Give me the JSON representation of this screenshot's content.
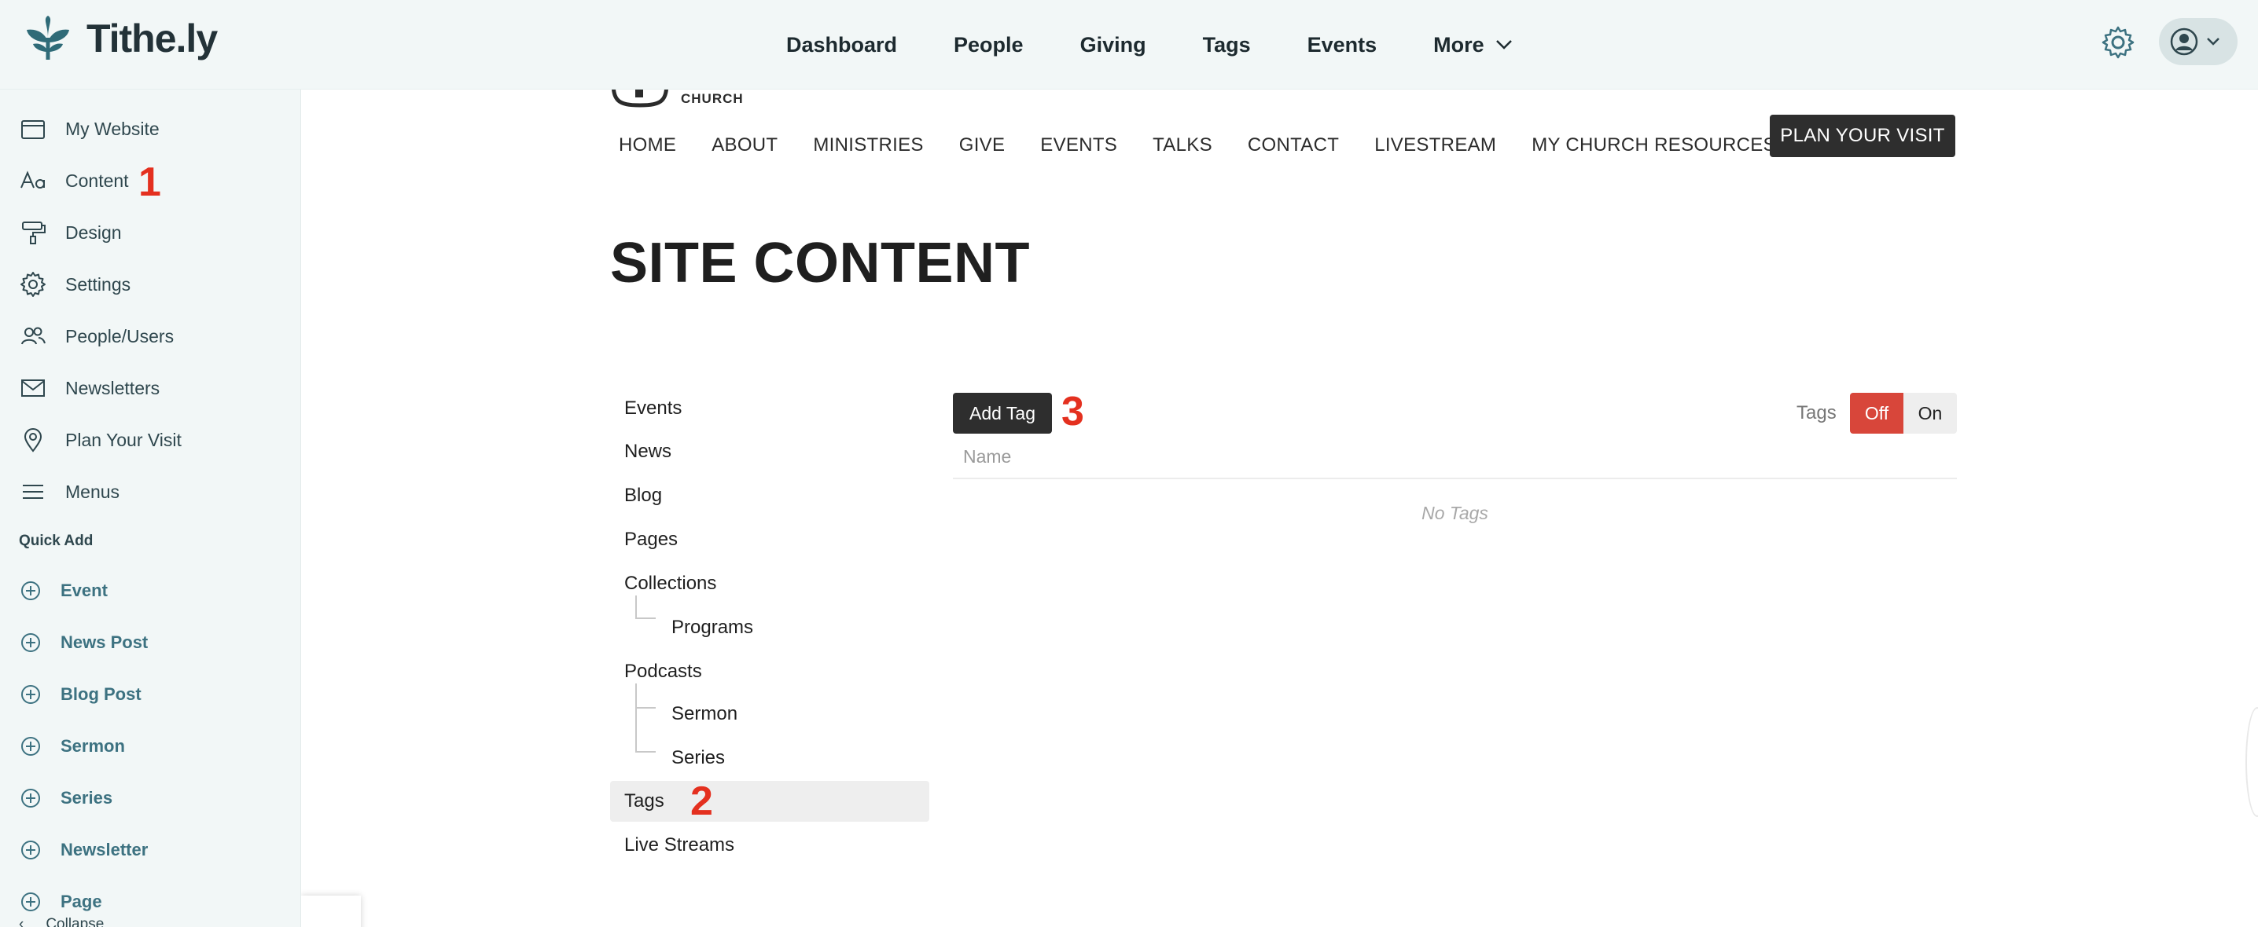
{
  "app": {
    "brand_name": "Tithe.ly",
    "accent_color": "#3d7281"
  },
  "topnav": {
    "items": [
      "Dashboard",
      "People",
      "Giving",
      "Tags",
      "Events",
      "More"
    ],
    "settings_icon": "gear-icon",
    "account_icon": "user-circle-icon"
  },
  "sidebar": {
    "items": [
      {
        "label": "My Website",
        "icon": "browser-window-icon"
      },
      {
        "label": "Content",
        "icon": "text-aa-icon"
      },
      {
        "label": "Design",
        "icon": "paint-roller-icon"
      },
      {
        "label": "Settings",
        "icon": "gear-icon"
      },
      {
        "label": "People/Users",
        "icon": "users-icon"
      },
      {
        "label": "Newsletters",
        "icon": "envelope-icon"
      },
      {
        "label": "Plan Your Visit",
        "icon": "map-pin-icon"
      },
      {
        "label": "Menus",
        "icon": "hamburger-menu-icon"
      }
    ],
    "quick_add_title": "Quick Add",
    "quick_add": [
      "Event",
      "News Post",
      "Blog Post",
      "Sermon",
      "Series",
      "Newsletter",
      "Page"
    ],
    "collapse_label": "Collapse"
  },
  "annotations": [
    "1",
    "2",
    "3"
  ],
  "site": {
    "logo_text": "CHURCH",
    "nav": [
      "HOME",
      "ABOUT",
      "MINISTRIES",
      "GIVE",
      "EVENTS",
      "TALKS",
      "CONTACT",
      "LIVESTREAM",
      "MY CHURCH RESOURCES"
    ],
    "plan_button": "PLAN YOUR VISIT",
    "page_title": "SITE CONTENT"
  },
  "content_nav": {
    "items": [
      {
        "label": "Events",
        "level": 0
      },
      {
        "label": "News",
        "level": 0
      },
      {
        "label": "Blog",
        "level": 0
      },
      {
        "label": "Pages",
        "level": 0
      },
      {
        "label": "Collections",
        "level": 0
      },
      {
        "label": "Programs",
        "level": 1
      },
      {
        "label": "Podcasts",
        "level": 0
      },
      {
        "label": "Sermon",
        "level": 1
      },
      {
        "label": "Series",
        "level": 1
      },
      {
        "label": "Tags",
        "level": 0,
        "active": true
      },
      {
        "label": "Live Streams",
        "level": 0
      }
    ]
  },
  "tags_panel": {
    "add_button": "Add Tag",
    "toggle_label": "Tags",
    "toggle_off": "Off",
    "toggle_on": "On",
    "toggle_state": "Off",
    "column_name": "Name",
    "empty_text": "No Tags"
  }
}
